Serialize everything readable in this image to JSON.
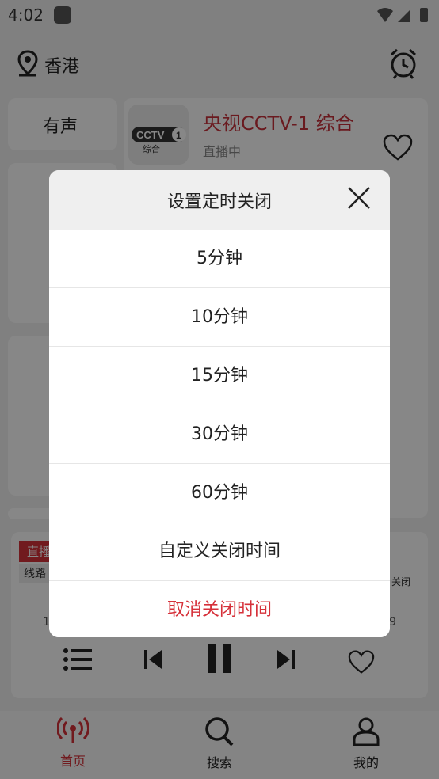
{
  "status": {
    "time": "4:02"
  },
  "header": {
    "location": "香港"
  },
  "left": {
    "mode_label": "有声"
  },
  "channel": {
    "name": "央视CCTV-1 综合",
    "status": "直播中",
    "logo_brand": "CCTV",
    "logo_number": "1",
    "logo_sub": "综合"
  },
  "player": {
    "live_tag": "直播",
    "line_tag": "线路",
    "close_label": "关闭",
    "number_left": "1",
    "number_right": "9"
  },
  "nav": {
    "home": "首页",
    "search": "搜索",
    "mine": "我的"
  },
  "dialog": {
    "title": "设置定时关闭",
    "options": [
      "5分钟",
      "10分钟",
      "15分钟",
      "30分钟",
      "60分钟",
      "自定义关闭时间"
    ],
    "cancel": "取消关闭时间"
  },
  "colors": {
    "accent": "#d6313a",
    "overlay": "rgba(0,0,0,0.47)"
  }
}
